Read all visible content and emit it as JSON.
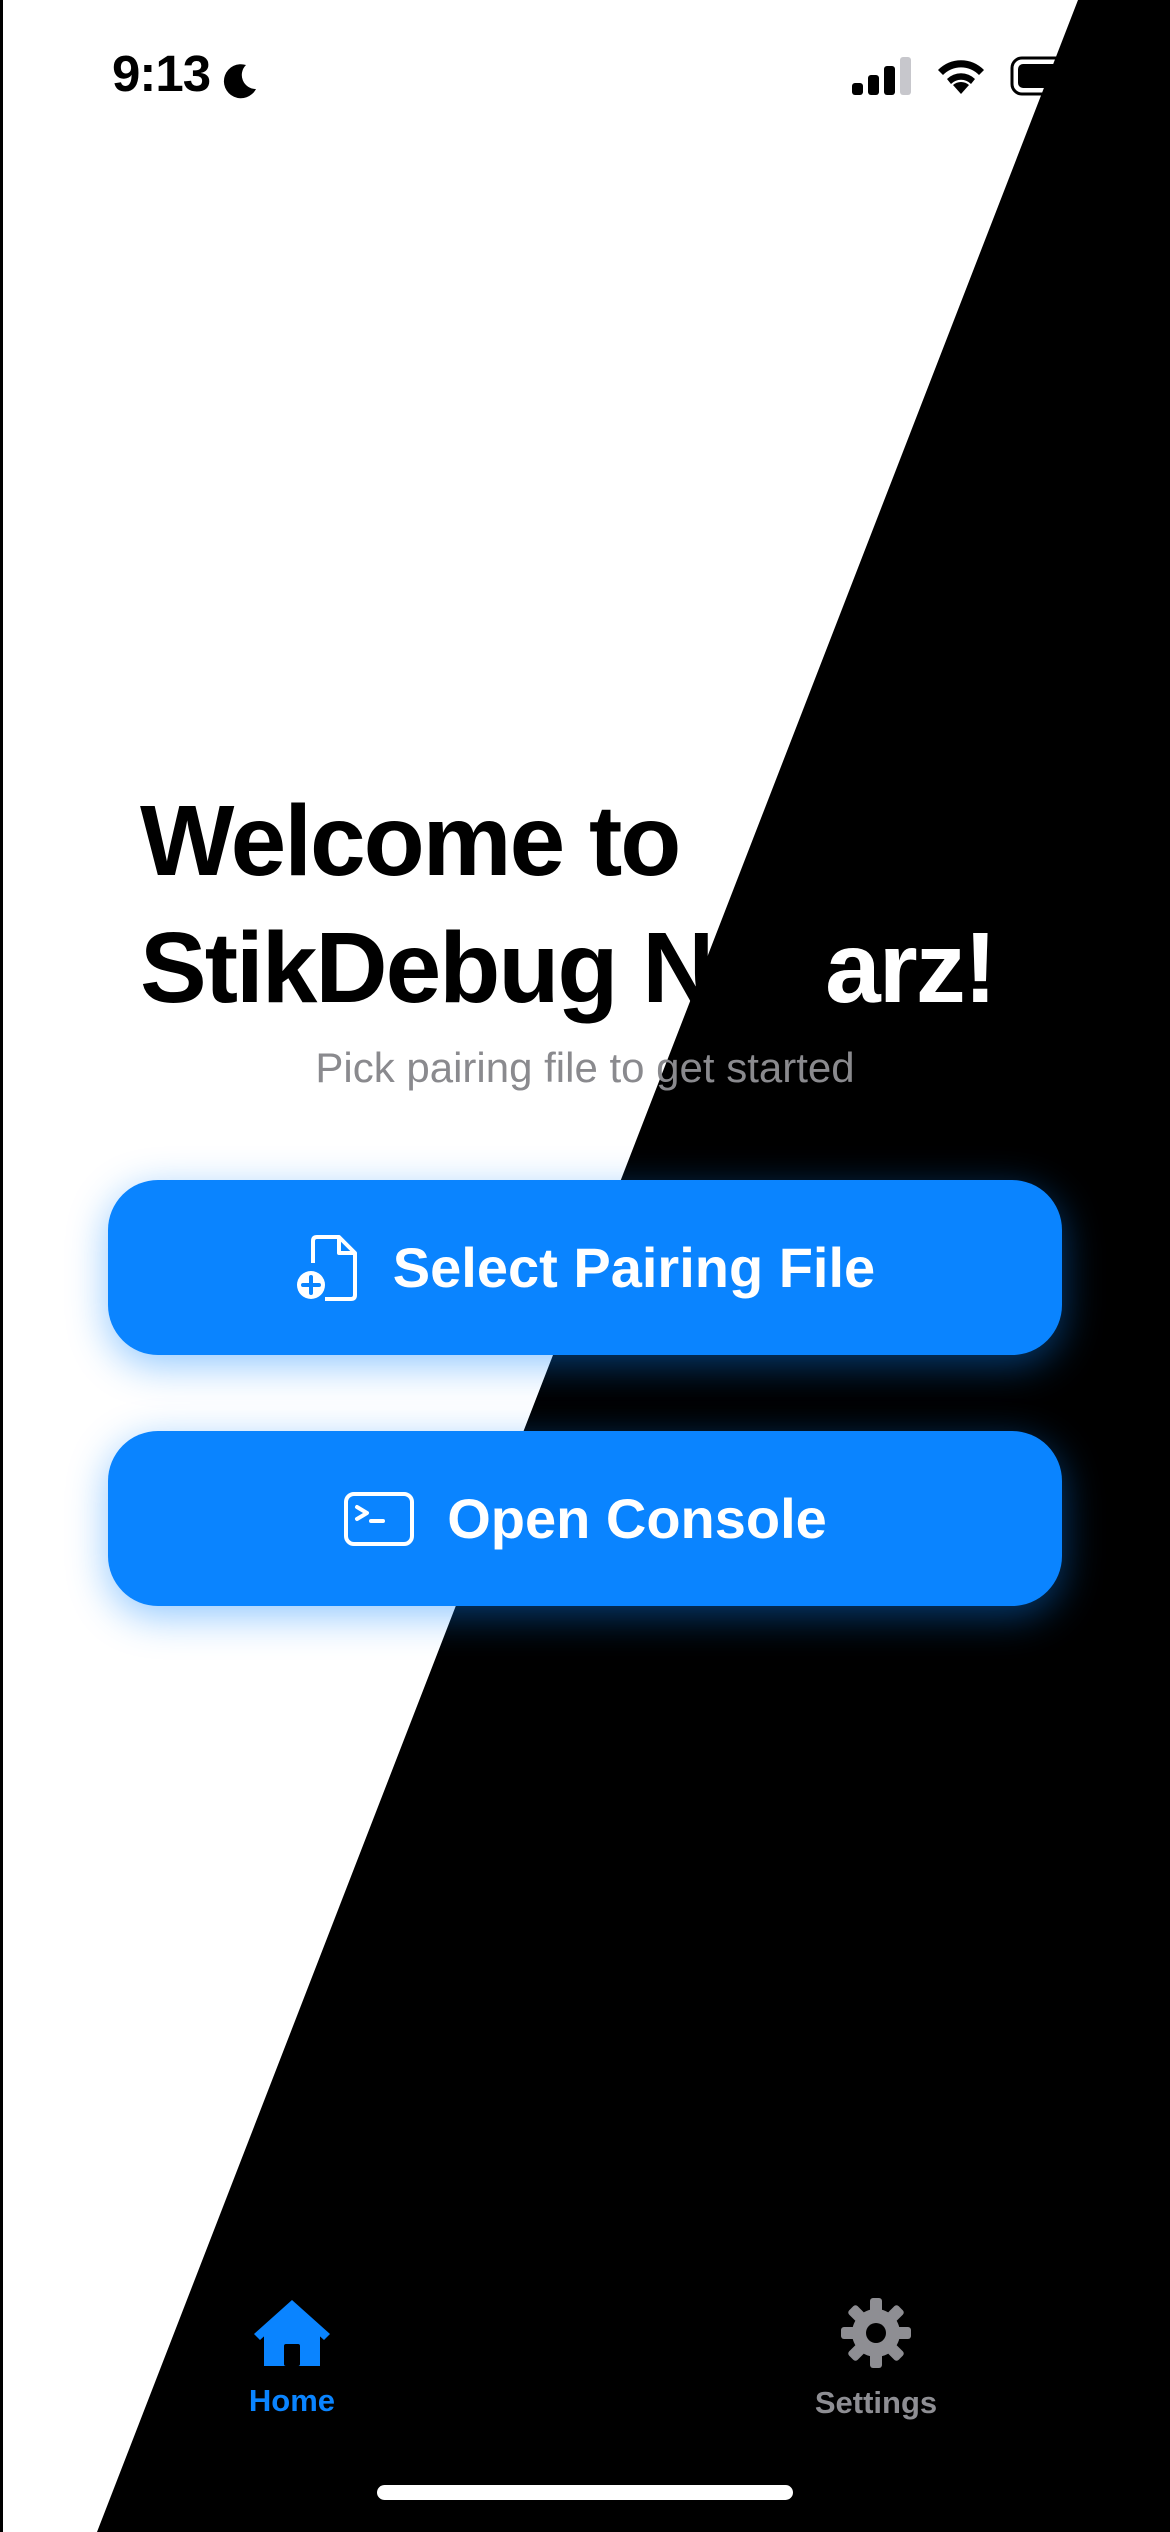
{
  "status_bar": {
    "time": "9:13",
    "moon_icon": "moon-icon",
    "signal_icon": "cellular-signal-icon",
    "wifi_icon": "wifi-icon",
    "battery_icon": "battery-icon"
  },
  "main": {
    "title_line1": "Welcome to",
    "title_line2": "StikDebug Neoarz!",
    "subtitle": "Pick pairing file to get started",
    "buttons": [
      {
        "label": "Select Pairing File",
        "icon": "document-add-icon"
      },
      {
        "label": "Open Console",
        "icon": "terminal-icon"
      }
    ]
  },
  "tab_bar": {
    "tabs": [
      {
        "label": "Home",
        "icon": "house-icon",
        "selected": true
      },
      {
        "label": "Settings",
        "icon": "gear-icon",
        "selected": false
      }
    ]
  },
  "colors": {
    "accent": "#0a84ff",
    "background_light": "#ffffff",
    "background_dark": "#000000",
    "subtitle_gray": "#8a8a8e",
    "inactive_tab": "#8e8e93"
  }
}
